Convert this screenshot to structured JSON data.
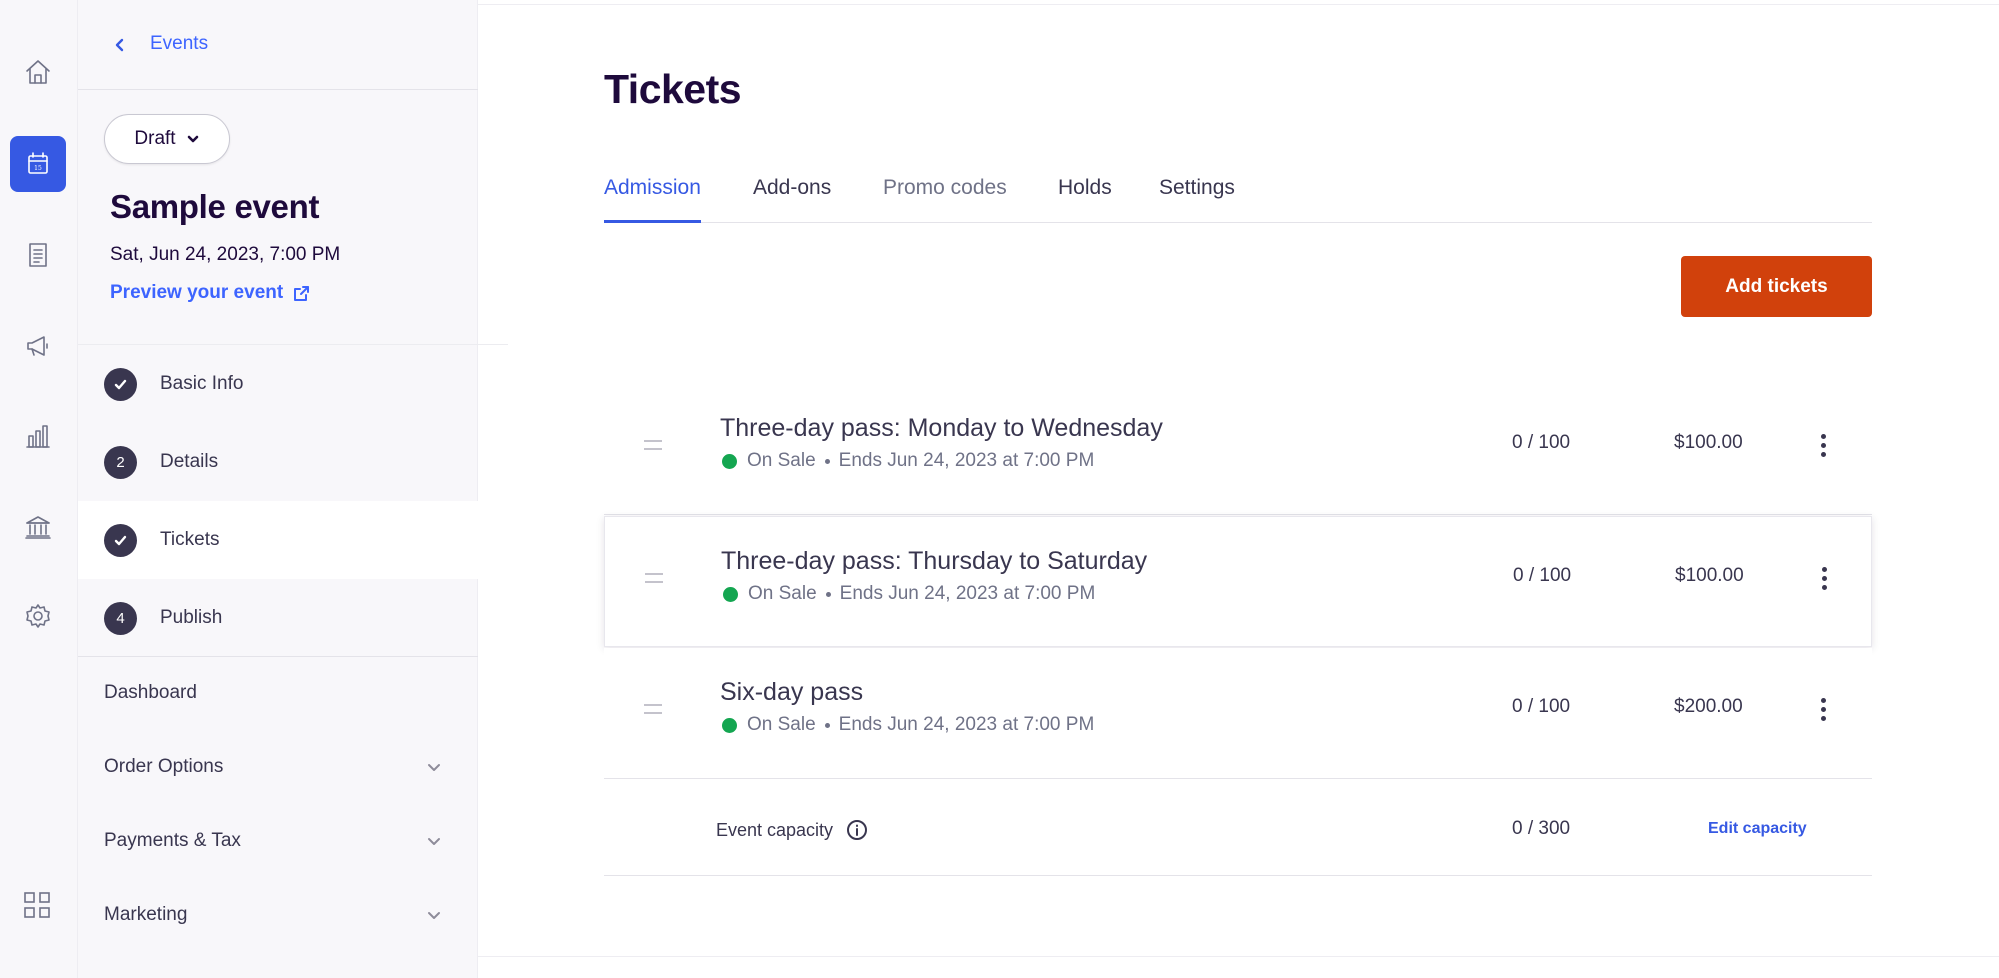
{
  "rail": {
    "items": [
      {
        "name": "home-icon",
        "active": false
      },
      {
        "name": "calendar-icon",
        "active": true,
        "badge": "15"
      },
      {
        "name": "orders-icon",
        "active": false
      },
      {
        "name": "megaphone-icon",
        "active": false
      },
      {
        "name": "bar-chart-icon",
        "active": false
      },
      {
        "name": "bank-icon",
        "active": false
      },
      {
        "name": "gear-icon",
        "active": false
      }
    ],
    "apps_icon": "grid-icon",
    "accent": "#3659e3"
  },
  "sidebar": {
    "back_label": "Events",
    "status_label": "Draft",
    "event_title": "Sample event",
    "event_date": "Sat, Jun 24, 2023, 7:00 PM",
    "preview_label": "Preview your event",
    "steps": [
      {
        "number": "1",
        "label": "Basic Info",
        "done": true
      },
      {
        "number": "2",
        "label": "Details",
        "done": false
      },
      {
        "number": "3",
        "label": "Tickets",
        "done": true
      },
      {
        "number": "4",
        "label": "Publish",
        "done": false
      }
    ],
    "nav": {
      "dashboard": "Dashboard",
      "order_options": "Order Options",
      "payments_tax": "Payments & Tax",
      "marketing": "Marketing"
    }
  },
  "main": {
    "title": "Tickets",
    "tabs": {
      "admission": "Admission",
      "addons": "Add-ons",
      "promo": "Promo codes",
      "holds": "Holds",
      "settings": "Settings"
    },
    "add_button": "Add tickets",
    "add_button_color": "#d1410c",
    "tickets": [
      {
        "name": "Three-day pass: Monday to Wednesday",
        "status": "On Sale",
        "ends": "Ends Jun 24, 2023 at 7:00 PM",
        "quantity": "0 / 100",
        "price": "$100.00"
      },
      {
        "name": "Three-day pass: Thursday to Saturday",
        "status": "On Sale",
        "ends": "Ends Jun 24, 2023 at 7:00 PM",
        "quantity": "0 / 100",
        "price": "$100.00"
      },
      {
        "name": "Six-day pass",
        "status": "On Sale",
        "ends": "Ends Jun 24, 2023 at 7:00 PM",
        "quantity": "0 / 100",
        "price": "$200.00"
      }
    ],
    "status_color": "#14a651",
    "capacity": {
      "label": "Event capacity",
      "quantity": "0 / 300",
      "edit_label": "Edit capacity"
    }
  }
}
